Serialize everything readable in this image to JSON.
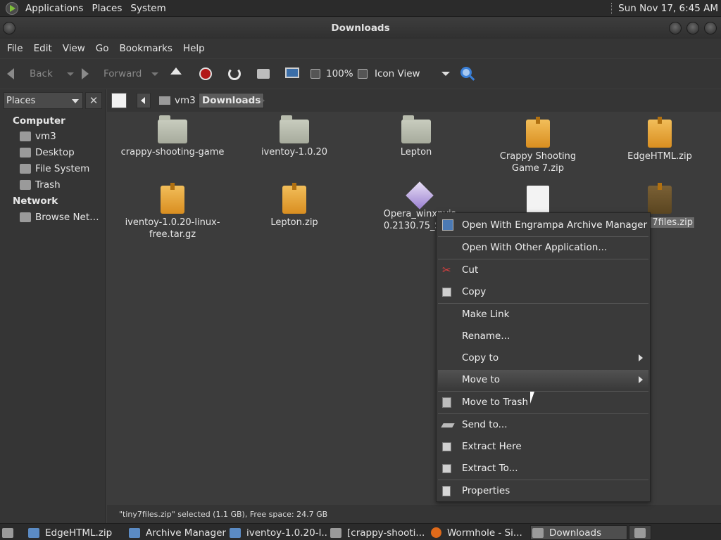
{
  "top_panel": {
    "menus": [
      "Applications",
      "Places",
      "System"
    ],
    "clock": "Sun Nov 17,  6:45 AM"
  },
  "window": {
    "title": "Downloads"
  },
  "menubar": [
    "File",
    "Edit",
    "View",
    "Go",
    "Bookmarks",
    "Help"
  ],
  "toolbar": {
    "back": "Back",
    "forward": "Forward",
    "zoom": "100%",
    "view_mode": "Icon View"
  },
  "sidebar": {
    "selector": "Places",
    "close": "✕",
    "computer_label": "Computer",
    "computer_items": [
      "vm3",
      "Desktop",
      "File System",
      "Trash"
    ],
    "network_label": "Network",
    "network_items": [
      "Browse Net…"
    ]
  },
  "location": {
    "crumbs": [
      "vm3",
      "Downloads"
    ]
  },
  "files": [
    {
      "name": "crappy-shooting-game",
      "type": "folder"
    },
    {
      "name": "iventoy-1.0.20",
      "type": "folder"
    },
    {
      "name": "Lepton",
      "type": "folder"
    },
    {
      "name": "Crappy Shooting Game 7.zip",
      "type": "zip"
    },
    {
      "name": "EdgeHTML.zip",
      "type": "zip"
    },
    {
      "name": "iventoy-1.0.20-linux-free.tar.gz",
      "type": "zip"
    },
    {
      "name": "Lepton.zip",
      "type": "zip"
    },
    {
      "name": "Opera_winxpvis 0.2130.75_Setu",
      "type": "installer"
    },
    {
      "name": "",
      "type": "document"
    },
    {
      "name": "7files.zip",
      "type": "zip",
      "selected": true
    }
  ],
  "status": "\"tiny7files.zip\" selected (1.1 GB), Free space: 24.7 GB",
  "context_menu": {
    "items": [
      {
        "label": "Open With Engrampa Archive Manager",
        "icon": "archive-icon"
      },
      {
        "label": "Open With Other Application...",
        "icon": ""
      },
      {
        "label": "Cut",
        "icon": "scissors-icon"
      },
      {
        "label": "Copy",
        "icon": "copy-icon"
      },
      {
        "label": "Make Link",
        "icon": ""
      },
      {
        "label": "Rename...",
        "icon": ""
      },
      {
        "label": "Copy to",
        "icon": "",
        "submenu": true
      },
      {
        "label": "Move to",
        "icon": "",
        "submenu": true,
        "highlighted": true
      },
      {
        "label": "Move to Trash",
        "icon": "trash-icon"
      },
      {
        "label": "Send to...",
        "icon": "send-icon"
      },
      {
        "label": "Extract Here",
        "icon": "extract-icon"
      },
      {
        "label": "Extract To...",
        "icon": "extract-icon"
      },
      {
        "label": "Properties",
        "icon": "properties-icon"
      }
    ]
  },
  "taskbar": [
    {
      "label": "EdgeHTML.zip"
    },
    {
      "label": "Archive Manager"
    },
    {
      "label": "iventoy-1.0.20-l..."
    },
    {
      "label": "[crappy-shooti..."
    },
    {
      "label": "Wormhole - Si..."
    },
    {
      "label": "Downloads",
      "active": true
    }
  ]
}
